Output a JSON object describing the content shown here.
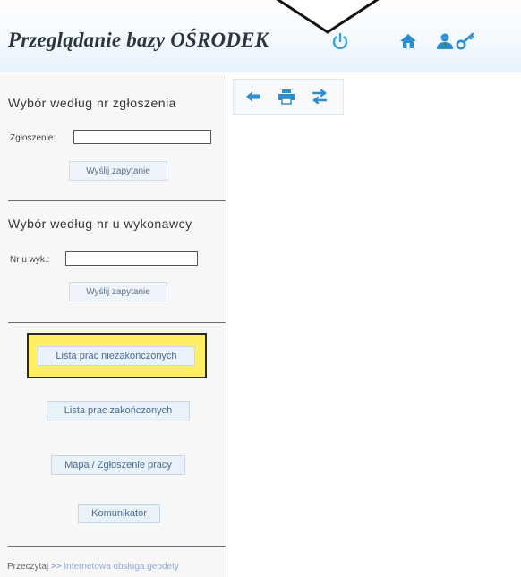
{
  "header": {
    "title": "Przeglądanie bazy OŚRODEK",
    "icons": [
      "power-icon",
      "home-icon",
      "user-icon",
      "key-icon"
    ]
  },
  "toolbar": {
    "icons": [
      "back-arrow-icon",
      "printer-icon",
      "swap-arrows-icon"
    ]
  },
  "sidebar": {
    "section1": {
      "title": "Wybór według nr zgłoszenia",
      "field_label": "Zgłoszenie:",
      "field_value": "",
      "button": "Wyślij zapytanie"
    },
    "section2": {
      "title": "Wybór według nr u wykonawcy",
      "field_label": "Nr u wyk.:",
      "field_value": "",
      "button": "Wyślij zapytanie"
    },
    "buttons": [
      "Lista prac niezakończonych",
      "Lista prac zakończonych",
      "Mapa / Zgłoszenie pracy",
      "Komunikator"
    ],
    "footer": {
      "prefix": "Przeczytaj",
      "arrows": ">>",
      "link": "Internetowa obsługa geodety"
    }
  },
  "colors": {
    "highlight": "#ffee66",
    "icon_blue": "#2d8fd0",
    "icon_green": "#2e8b57",
    "power_blue": "#3a9ee0"
  }
}
